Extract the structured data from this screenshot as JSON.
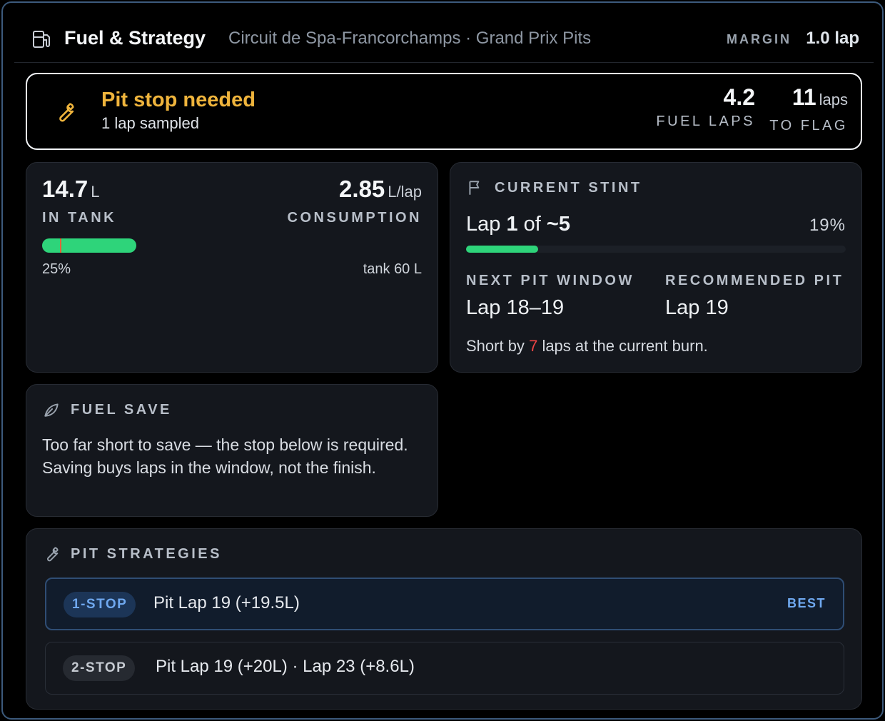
{
  "header": {
    "title": "Fuel & Strategy",
    "track": "Circuit de Spa-Francorchamps · Grand Prix Pits",
    "margin_label": "MARGIN",
    "margin_value": "1.0 lap"
  },
  "alert": {
    "title": "Pit stop needed",
    "subtitle": "1 lap sampled",
    "fuel_laps_value": "4.2",
    "fuel_laps_label": "FUEL LAPS",
    "to_flag_value": "11",
    "to_flag_unit": "laps",
    "to_flag_label": "TO FLAG"
  },
  "tank": {
    "in_tank_value": "14.7",
    "in_tank_unit": "L",
    "in_tank_label": "IN TANK",
    "consumption_value": "2.85",
    "consumption_unit": "L/lap",
    "consumption_label": "CONSUMPTION",
    "fill_percent": 25,
    "fill_percent_text": "25%",
    "capacity_text": "tank 60 L"
  },
  "stint": {
    "label": "CURRENT STINT",
    "lap_prefix": "Lap",
    "lap_current": "1",
    "lap_of": "of",
    "lap_total": "~5",
    "progress_percent": 19,
    "progress_text": "19%",
    "next_window_label": "NEXT PIT WINDOW",
    "next_window_value": "Lap 18–19",
    "recommended_label": "RECOMMENDED PIT",
    "recommended_value": "Lap 19",
    "note_prefix": "Short by",
    "note_count": "7",
    "note_suffix": "laps at the current burn."
  },
  "fuel_save": {
    "label": "FUEL SAVE",
    "text": "Too far short to save — the stop below is required. Saving buys laps in the window, not the finish."
  },
  "strategies": {
    "label": "PIT STRATEGIES",
    "items": [
      {
        "tag": "1-STOP",
        "plan": "Pit Lap 19 (+19.5L)",
        "badge": "BEST"
      },
      {
        "tag": "2-STOP",
        "plan": "Pit Lap 19 (+20L) · Lap 23 (+8.6L)"
      }
    ]
  },
  "colors": {
    "accent_green": "#2ed47a",
    "warning_amber": "#efb43c",
    "alert_red": "#ef4444",
    "best_blue": "#6fa8ef"
  }
}
